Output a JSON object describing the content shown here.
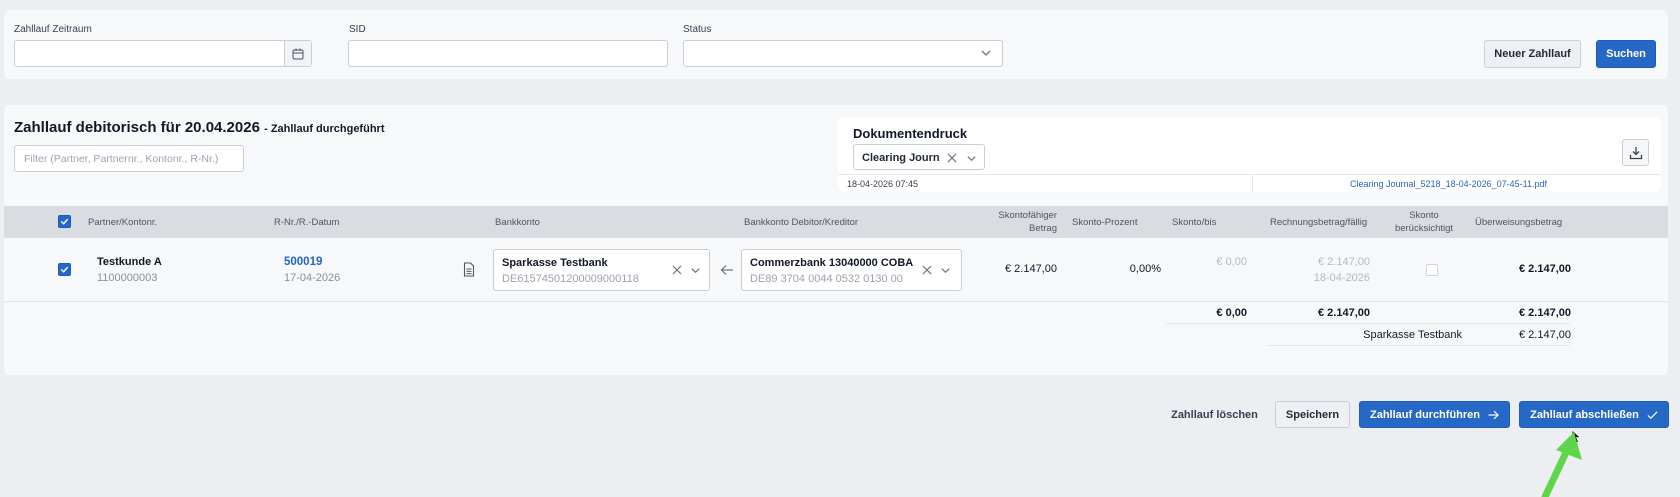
{
  "filters": {
    "period_label": "Zahllauf Zeitraum",
    "period_value": "",
    "sid_label": "SID",
    "sid_value": "",
    "status_label": "Status",
    "status_value": "",
    "new_run_label": "Neuer Zahllauf",
    "search_label": "Suchen"
  },
  "run": {
    "title": "Zahllauf debitorisch für 20.04.2026",
    "status_suffix": "- Zahllauf durchgeführt",
    "filter_placeholder": "Filter (Partner, Partnernr., Kontonr., R-Nr.)"
  },
  "document": {
    "title": "Dokumentendruck",
    "selected": "Clearing Journal",
    "timestamp": "18-04-2026 07:45",
    "file_link": "Clearing Journal_5218_18-04-2026_07-45-11.pdf"
  },
  "table": {
    "headers": {
      "partner": "Partner/Kontonr.",
      "invoice": "R-Nr./R.-Datum",
      "bank_account": "Bankkonto",
      "partner_bank": "Bankkonto Debitor/Kreditor",
      "discountable_1": "Skontofähiger",
      "discountable_2": "Betrag",
      "discount_pct": "Skonto-Prozent",
      "discount_until": "Skonto/bis",
      "invoice_amount": "Rechnungsbetrag/fällig",
      "discount_considered_1": "Skonto",
      "discount_considered_2": "berücksichtigt",
      "transfer_amount": "Überweisungsbetrag"
    },
    "rows": [
      {
        "partner_name": "Testkunde A",
        "account_no": "1100000003",
        "invoice_no": "500019",
        "invoice_date": "17-04-2026",
        "bank_name": "Sparkasse Testbank",
        "bank_iban": "DE61574501200009000118",
        "partner_bank_name": "Commerzbank 13040000 COBA",
        "partner_bank_iban": "DE89 3704 0044 0532 0130 00",
        "discountable_amount": "€ 2.147,00",
        "discount_pct": "0,00%",
        "discount_amount": "€ 0,00",
        "invoice_amount": "€ 2.147,00",
        "due_date": "18-04-2026",
        "transfer_amount": "€ 2.147,00"
      }
    ],
    "totals": {
      "discount": "€ 0,00",
      "invoice": "€ 2.147,00",
      "transfer": "€ 2.147,00",
      "bank_label": "Sparkasse Testbank",
      "bank_total": "€ 2.147,00"
    }
  },
  "actions": {
    "delete_label": "Zahllauf löschen",
    "save_label": "Speichern",
    "execute_label": "Zahllauf durchführen",
    "complete_label": "Zahllauf abschließen"
  },
  "colors": {
    "primary": "#2668c6",
    "link": "#2563c6",
    "annotation_arrow": "#5fd64a"
  }
}
